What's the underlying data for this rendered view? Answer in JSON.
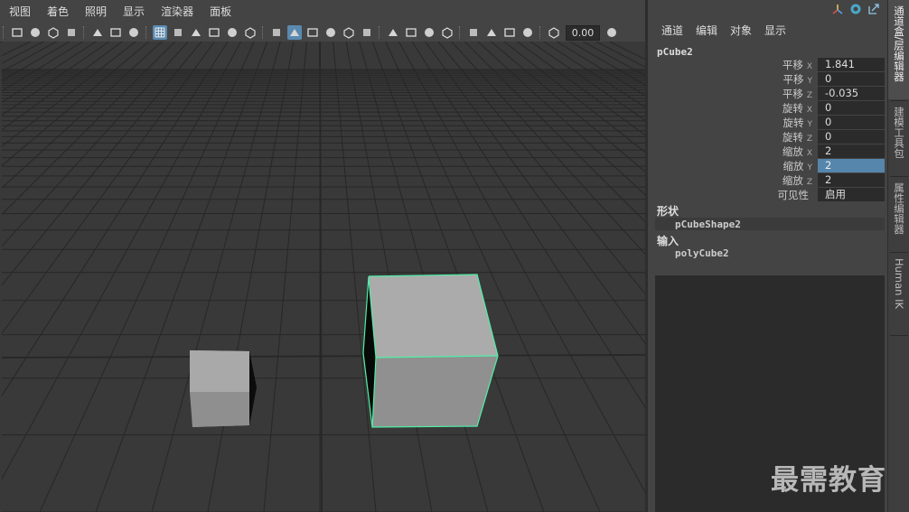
{
  "viewport": {
    "menus": [
      "视图",
      "着色",
      "照明",
      "显示",
      "渲染器",
      "面板"
    ],
    "time_value": "0.00",
    "background_color": "#393939",
    "grid_color": "#272727",
    "selection_color": "#4ef0a8",
    "toolbar_icons": [
      "camera-select-icon",
      "camera-attributes-icon",
      "bookmark-icon",
      "film-camera-icon",
      "image-plane-icon",
      "2d-pan-zoom-icon",
      "grease-pencil-icon",
      "grid-icon",
      "film-gate-icon",
      "resolution-gate-icon",
      "gate-mask-icon",
      "field-chart-icon",
      "safe-action-icon",
      "wireframe-icon",
      "smooth-shade-icon",
      "default-material-icon",
      "xray-icon",
      "use-all-lights-icon",
      "shadows-icon",
      "screen-space-ao-icon",
      "motion-blur-icon",
      "multisample-aa-icon",
      "depth-of-field-icon",
      "isolate-select-icon",
      "xray-joints-icon",
      "xray-active-icon",
      "backface-culling-icon",
      "exposure-icon"
    ]
  },
  "channel_box": {
    "header_icons": [
      "tool-icon",
      "lasso-pin-icon",
      "external-link-icon"
    ],
    "menus": [
      "通道",
      "编辑",
      "对象",
      "显示"
    ],
    "node_name": "pCube2",
    "attributes": [
      {
        "label": "平移",
        "axis": "X",
        "value": "1.841",
        "selected": false
      },
      {
        "label": "平移",
        "axis": "Y",
        "value": "0",
        "selected": false
      },
      {
        "label": "平移",
        "axis": "Z",
        "value": "-0.035",
        "selected": false
      },
      {
        "label": "旋转",
        "axis": "X",
        "value": "0",
        "selected": false
      },
      {
        "label": "旋转",
        "axis": "Y",
        "value": "0",
        "selected": false
      },
      {
        "label": "旋转",
        "axis": "Z",
        "value": "0",
        "selected": false
      },
      {
        "label": "缩放",
        "axis": "X",
        "value": "2",
        "selected": false
      },
      {
        "label": "缩放",
        "axis": "Y",
        "value": "2",
        "selected": true
      },
      {
        "label": "缩放",
        "axis": "Z",
        "value": "2",
        "selected": false
      },
      {
        "label": "可见性",
        "axis": "",
        "value": "启用",
        "selected": false
      }
    ],
    "shapes_heading": "形状",
    "shape_node": "pCubeShape2",
    "inputs_heading": "输入",
    "input_node": "polyCube2",
    "selected_color": "#5686ab"
  },
  "side_tabs": [
    {
      "label": "通道盒/层编辑器",
      "active": true
    },
    {
      "label": "建模工具包",
      "active": false
    },
    {
      "label": "属性编辑器",
      "active": false
    },
    {
      "label": "Human IK",
      "active": false
    }
  ],
  "watermark": "最需教育"
}
